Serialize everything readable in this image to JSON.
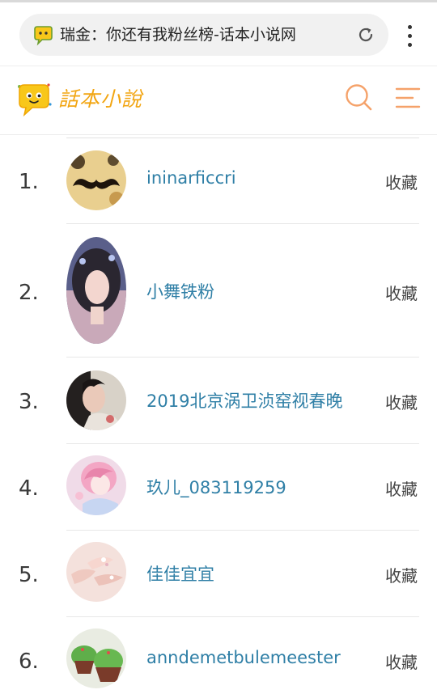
{
  "browser": {
    "url_text": "瑞金：你还有我粉丝榜-话本小说网"
  },
  "header": {
    "logo_text": "話本小說",
    "accent_color": "#f5a623"
  },
  "rows": [
    {
      "rank": "1.",
      "name": "ininarficcri",
      "action": "收藏"
    },
    {
      "rank": "2.",
      "name": "小舞铁粉",
      "action": "收藏"
    },
    {
      "rank": "3.",
      "name": "2019北京涡卫浈窑视春晚",
      "action": "收藏"
    },
    {
      "rank": "4.",
      "name": "玖儿_083119259",
      "action": "收藏"
    },
    {
      "rank": "5.",
      "name": "佳佳宜宜",
      "action": "收藏"
    },
    {
      "rank": "6.",
      "name": "anndemetbulemeester",
      "action": "收藏"
    }
  ],
  "icons": [
    "chat-favicon-icon",
    "reload-icon",
    "more-vert-icon",
    "logo-mascot-icon",
    "search-icon",
    "menu-icon"
  ]
}
